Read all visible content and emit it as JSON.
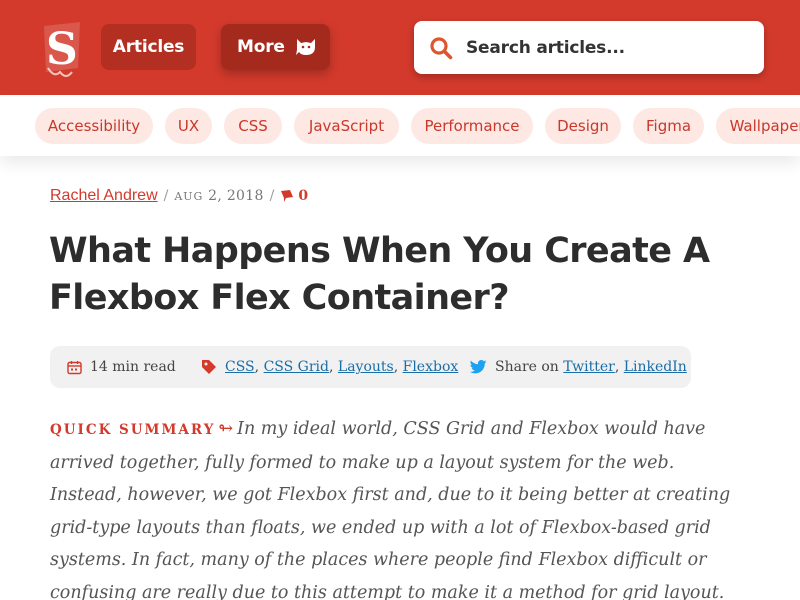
{
  "header": {
    "logo_letter": "S",
    "nav": {
      "articles_label": "Articles",
      "more_label": "More"
    },
    "search": {
      "placeholder": "Search articles..."
    },
    "brand_color": "#d33a2c"
  },
  "tags": [
    "Accessibility",
    "UX",
    "CSS",
    "JavaScript",
    "Performance",
    "Design",
    "Figma",
    "Wallpapers"
  ],
  "article": {
    "author": "Rachel Andrew",
    "date_month": "Aug",
    "date_rest": " 2, 2018",
    "comments": "0",
    "title": "What Happens When You Create A Flexbox Flex Container?",
    "read_time": "14 min read",
    "topics": [
      "CSS",
      "CSS Grid",
      "Layouts",
      "Flexbox"
    ],
    "share_prefix": "Share on",
    "share_links": [
      "Twitter",
      "LinkedIn"
    ],
    "summary_label": "Quick summary",
    "summary_arrow": "↬",
    "summary_text": "In my ideal world, CSS Grid and Flexbox would have arrived together, fully formed to make up a layout system for the web. Instead, however, we got Flexbox first and, due to it being better at creating grid-type layouts than floats, we ended up with a lot of Flexbox-based grid systems. In fact, many of the places where people find Flexbox difficult or confusing are really due to this attempt to make it a method for grid layout."
  },
  "icons": {
    "logo": "smashing-logo-icon",
    "more": "cat-icon",
    "search": "search-icon",
    "comments": "comment-icon",
    "read_time": "calendar-icon",
    "topics": "tag-icon",
    "share": "twitter-icon"
  },
  "colors": {
    "accent": "#d33a2c",
    "tag_bg": "#fde8e4",
    "link": "#1a6ea8",
    "twitter": "#1da1f2"
  }
}
